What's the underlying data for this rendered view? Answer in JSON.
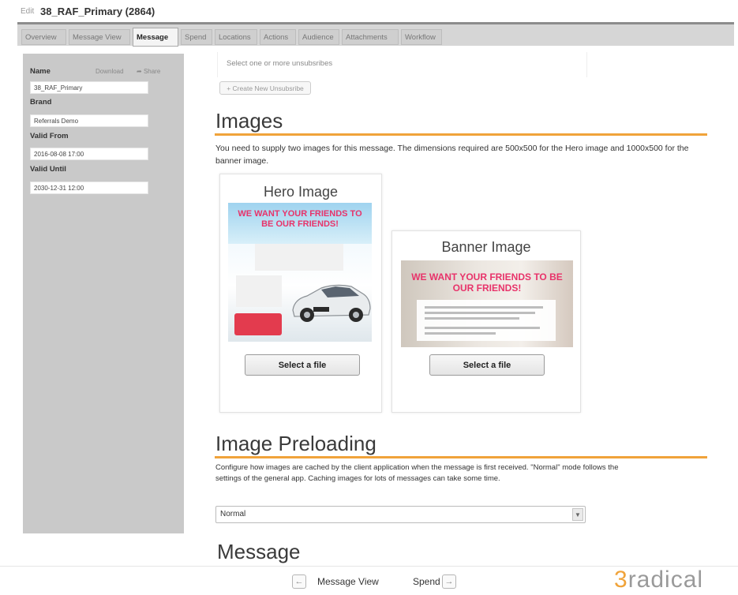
{
  "breadcrumb": {
    "edit_label": "Edit",
    "title": "38_RAF_Primary (2864)"
  },
  "tabs": [
    {
      "label": "Overview",
      "active": false
    },
    {
      "label": "Message View",
      "active": false
    },
    {
      "label": "Message",
      "active": true
    },
    {
      "label": "Spend",
      "active": false
    },
    {
      "label": "Locations",
      "active": false
    },
    {
      "label": "Actions",
      "active": false
    },
    {
      "label": "Audience",
      "active": false
    },
    {
      "label": "Attachments",
      "active": false
    },
    {
      "label": "Workflow",
      "active": false
    }
  ],
  "sidebar": {
    "name_label": "Name",
    "download_label": "Download",
    "share_label": "Share",
    "name_value": "38_RAF_Primary",
    "brand_label": "Brand",
    "brand_value": "Referrals Demo",
    "valid_from_label": "Valid From",
    "valid_from_value": "2016-08-08 17:00",
    "valid_until_label": "Valid Until",
    "valid_until_value": "2030-12-31 12:00"
  },
  "unsubscribes": {
    "hint": "Select one or more unsubsribes",
    "create_button": "+ Create New Unsubsribe"
  },
  "images": {
    "heading": "Images",
    "description": "You need to supply two images for this message. The dimensions required are 500x500 for the Hero image and 1000x500 for the banner image.",
    "hero": {
      "title": "Hero Image",
      "slogan": "WE WANT YOUR FRIENDS TO BE OUR FRIENDS!",
      "button": "Select a file"
    },
    "banner": {
      "title": "Banner Image",
      "slogan": "WE WANT YOUR FRIENDS TO BE OUR FRIENDS!",
      "button": "Select a file"
    }
  },
  "preloading": {
    "heading": "Image Preloading",
    "description": "Configure how images are cached by the client application when the message is first received. \"Normal\" mode follows the settings of the general app. Caching images for lots of messages can take some time.",
    "select_value": "Normal"
  },
  "message": {
    "heading": "Message"
  },
  "footer": {
    "prev_label": "Message View",
    "next_label": "Spend",
    "logo_mark": "3",
    "logo_text": "radical",
    "accent_color": "#f0a33a"
  }
}
